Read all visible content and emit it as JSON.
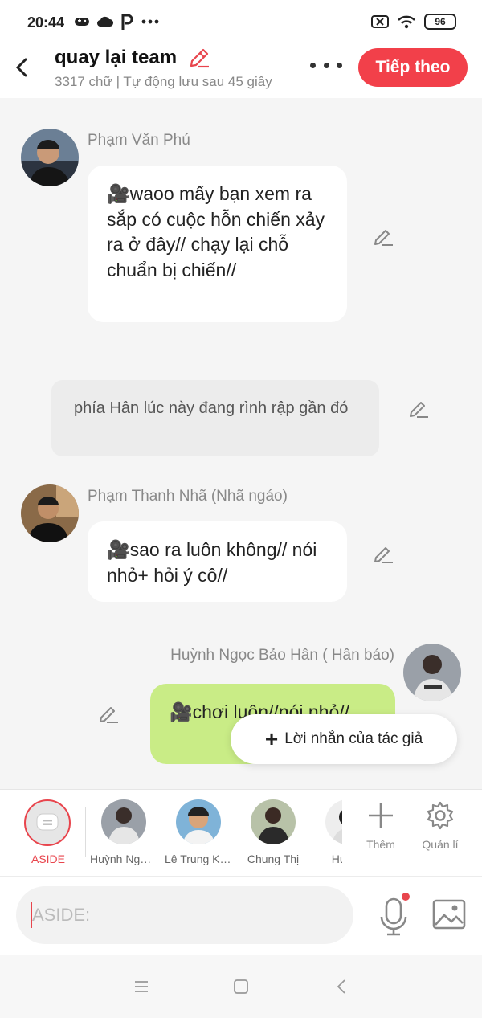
{
  "status_bar": {
    "time": "20:44",
    "battery": "96"
  },
  "header": {
    "title": "quay lại team",
    "subtitle": "3317 chữ | Tự động lưu sau 45 giây",
    "next_button": "Tiếp theo"
  },
  "messages": [
    {
      "sender": "Phạm Văn Phú",
      "text": "🎥waoo mấy bạn xem ra sắp có cuộc hỗn chiến xảy ra ở đây// chạy lại chỗ chuẩn bị chiến//"
    },
    {
      "narration": "phía Hân lúc này đang rình rập gần đó"
    },
    {
      "sender": "Phạm Thanh Nhã (Nhã ngáo)",
      "text": "🎥sao ra luôn không// nói nhỏ+ hỏi ý cô//"
    },
    {
      "sender": "Huỳnh Ngọc Bảo Hân ( Hân báo)",
      "text": "🎥chơi luôn//nói nhỏ//"
    }
  ],
  "toast": {
    "label": "Lời nhắn của tác giả"
  },
  "characters": {
    "aside_label": "ASIDE",
    "items": [
      "Huỳnh Ngọc Bảo Hân",
      "Lê Trung Kiên",
      "Chung Thị",
      "Huỳnh"
    ],
    "add_label": "Thêm",
    "manage_label": "Quản lí"
  },
  "input": {
    "placeholder": "ASIDE:"
  },
  "colors": {
    "accent": "#f2404a",
    "bubble_self": "#c9ec86",
    "background": "#f5f5f5"
  }
}
